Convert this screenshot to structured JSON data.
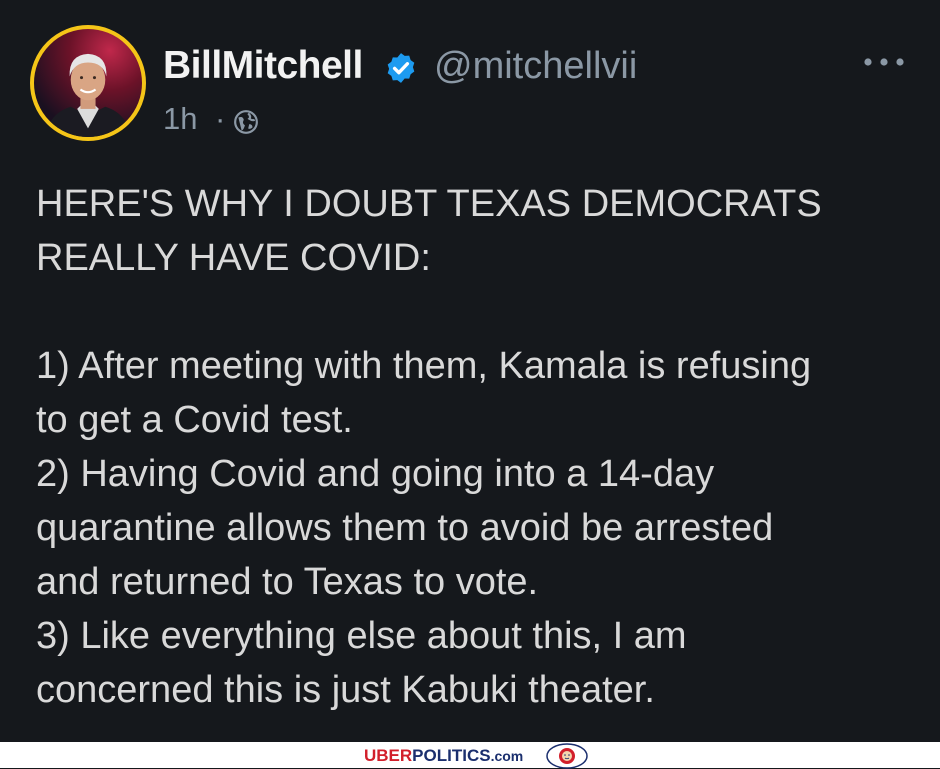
{
  "tweet": {
    "display_name": "BillMitchell",
    "handle": "@mitchellvii",
    "time": "1h",
    "separator": "·",
    "lines": [
      "HERE'S WHY I DOUBT TEXAS DEMOCRATS",
      "REALLY HAVE COVID:",
      "",
      "1) After meeting with them, Kamala is refusing",
      "to get a Covid test.",
      "2) Having Covid and going into a 14-day",
      "quarantine allows them to avoid be arrested",
      "and returned to Texas to vote.",
      "3) Like everything else about this, I am",
      "concerned this is just Kabuki theater."
    ]
  },
  "footer": {
    "brand_prefix": "UBER",
    "brand_main": "POLITICS",
    "brand_suffix": ".com"
  },
  "colors": {
    "background": "#15181c",
    "text": "#d9d9d9",
    "muted": "#8b98a5",
    "verified": "#1d9bf0",
    "avatar_ring": "#f5c518",
    "brand_red": "#d21f2b",
    "brand_blue": "#1b2f6e"
  },
  "icons": [
    "verified-badge-icon",
    "globe-icon",
    "more-options-icon",
    "lion-crest-icon"
  ]
}
